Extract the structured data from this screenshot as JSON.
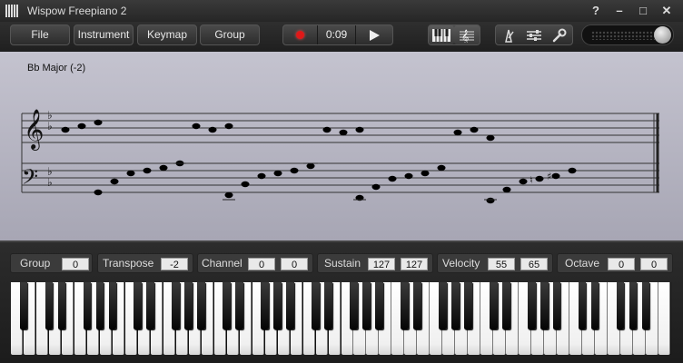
{
  "window": {
    "title": "Wispow Freepiano 2",
    "help": "?",
    "minimize": "–",
    "maximize": "□",
    "close": "✕"
  },
  "toolbar": {
    "file": "File",
    "instrument": "Instrument",
    "keymap": "Keymap",
    "group": "Group",
    "time": "0:09",
    "icons": [
      "piano-view-icon",
      "score-view-icon",
      "metronome-icon",
      "mixer-icon",
      "settings-wrench-icon"
    ]
  },
  "score": {
    "key_label": "Bb Major (-2)"
  },
  "controls": {
    "group": {
      "label": "Group",
      "values": [
        "0"
      ]
    },
    "transpose": {
      "label": "Transpose",
      "values": [
        "-2"
      ]
    },
    "channel": {
      "label": "Channel",
      "values": [
        "0",
        "0"
      ]
    },
    "sustain": {
      "label": "Sustain",
      "values": [
        "127",
        "127"
      ]
    },
    "velocity": {
      "label": "Velocity",
      "values": [
        "55",
        "65"
      ]
    },
    "octave": {
      "label": "Octave",
      "values": [
        "0",
        "0"
      ]
    }
  },
  "colors": {
    "record": "#e01818",
    "score_bg": "#b5b4c1"
  }
}
